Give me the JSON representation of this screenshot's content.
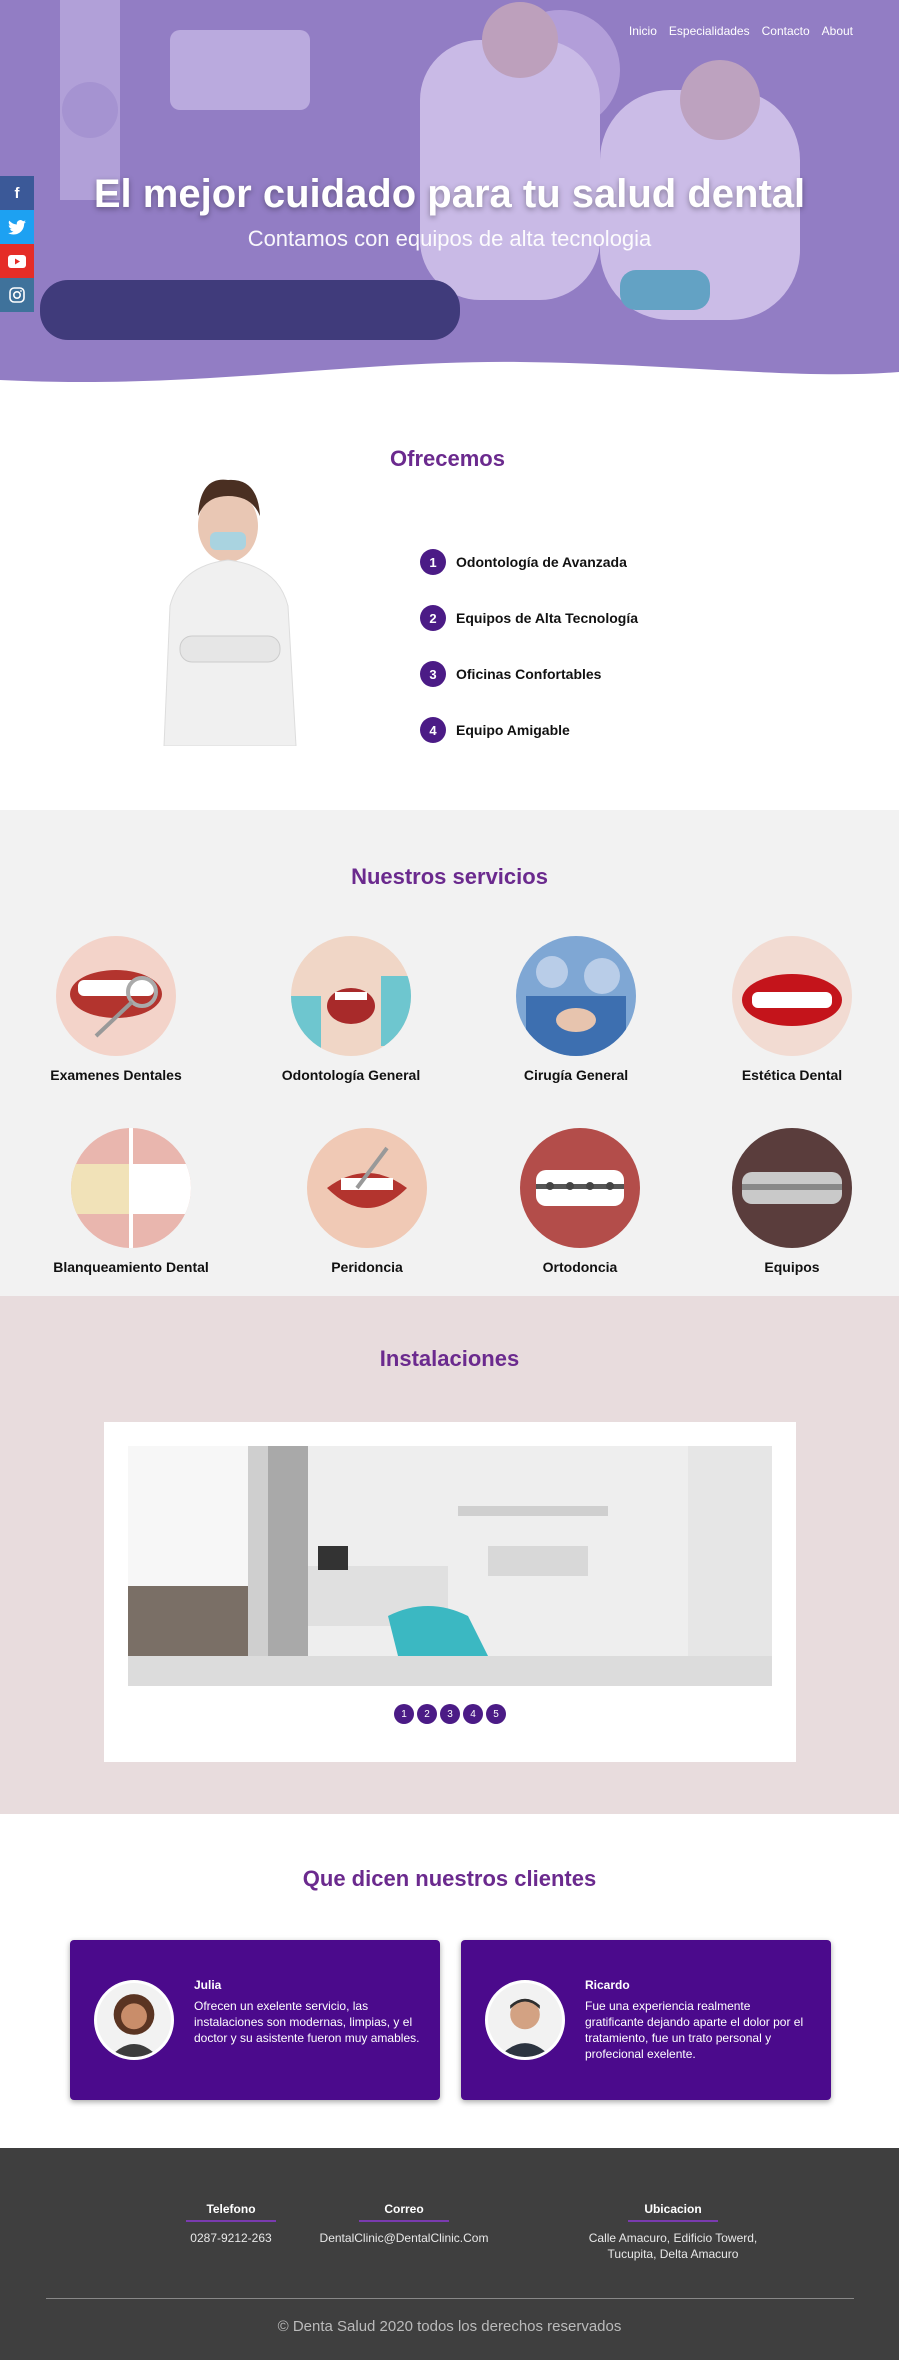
{
  "nav": {
    "items": [
      "Inicio",
      "Especialidades",
      "Contacto",
      "About"
    ]
  },
  "social": [
    "facebook-icon",
    "twitter-icon",
    "youtube-icon",
    "instagram-icon"
  ],
  "hero": {
    "title": "El mejor cuidado para tu salud dental",
    "subtitle": "Contamos con equipos de alta tecnologia"
  },
  "offer": {
    "title": "Ofrecemos",
    "items": [
      {
        "num": "1",
        "label": "Odontología de Avanzada"
      },
      {
        "num": "2",
        "label": "Equipos de Alta Tecnología"
      },
      {
        "num": "3",
        "label": "Oficinas Confortables"
      },
      {
        "num": "4",
        "label": "Equipo Amigable"
      }
    ]
  },
  "services": {
    "title": "Nuestros servicios",
    "items": [
      {
        "label": "Examenes Dentales"
      },
      {
        "label": "Odontología General"
      },
      {
        "label": "Cirugía General"
      },
      {
        "label": "Estética Dental"
      },
      {
        "label": "Blanqueamiento Dental"
      },
      {
        "label": "Peridoncia"
      },
      {
        "label": "Ortodoncia"
      },
      {
        "label": "Equipos"
      }
    ]
  },
  "install": {
    "title": "Instalaciones",
    "dots": [
      "1",
      "2",
      "3",
      "4",
      "5"
    ]
  },
  "clients": {
    "title": "Que dicen nuestros clientes",
    "reviews": [
      {
        "name": "Julia",
        "text": "Ofrecen un exelente servicio, las instalaciones son modernas, limpias, y el doctor y su asistente fueron muy amables."
      },
      {
        "name": "Ricardo",
        "text": "Fue una experiencia realmente gratificante dejando aparte el dolor por el tratamiento, fue un trato personal y profecional exelente."
      }
    ]
  },
  "footer": {
    "phone_label": "Telefono",
    "phone": "0287-9212-263",
    "email_label": "Correo",
    "email": "DentalClinic@DentalClinic.Com",
    "location_label": "Ubicacion",
    "location_line1": "Calle Amacuro, Edificio Towerd,",
    "location_line2": "Tucupita, Delta Amacuro",
    "copyright": "© Denta Salud 2020 todos los derechos reservados"
  }
}
